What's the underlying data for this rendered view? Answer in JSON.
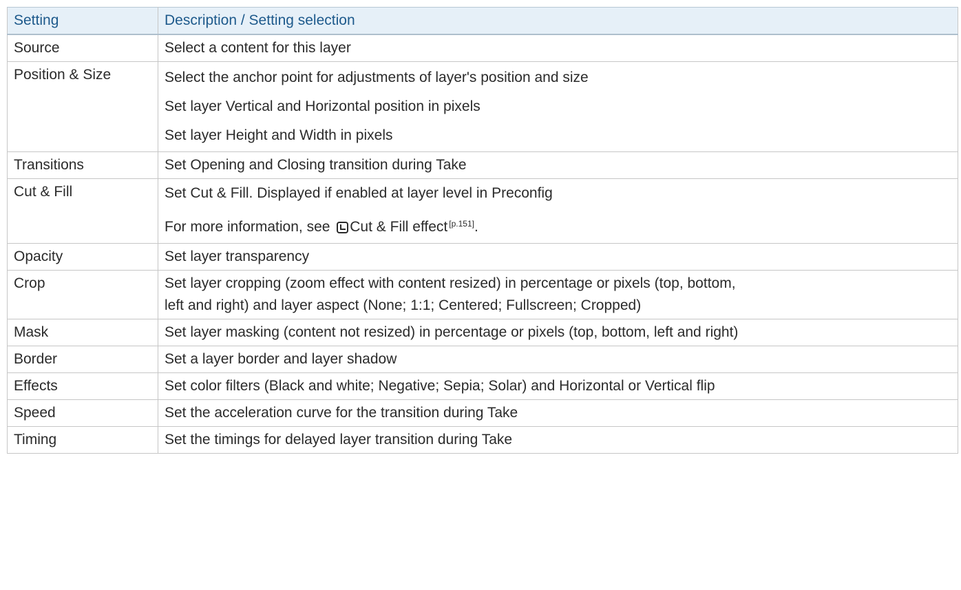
{
  "header": {
    "setting": "Setting",
    "description": "Description / Setting selection"
  },
  "rows": [
    {
      "setting": "Source",
      "lines": [
        "Select a content for this layer"
      ]
    },
    {
      "setting": "Position & Size",
      "lines": [
        "Select the anchor point for adjustments of layer's position and size",
        "Set layer Vertical and Horizontal position in pixels",
        "Set layer Height and Width in pixels"
      ]
    },
    {
      "setting": "Transitions",
      "lines": [
        "Set Opening and Closing transition during Take"
      ]
    },
    {
      "setting": "Cut & Fill",
      "lines": [
        "Set Cut & Fill. Displayed if enabled at layer level in Preconfig"
      ],
      "reference": {
        "prefix": "For more information, see ",
        "link_text": "Cut & Fill effect",
        "page_ref": "[p.151]",
        "suffix": ".",
        "icon": "link-arrow-icon"
      }
    },
    {
      "setting": "Opacity",
      "lines": [
        "Set layer transparency"
      ]
    },
    {
      "setting": "Crop",
      "lines": [
        "Set layer cropping (zoom effect with content resized) in percentage or pixels (top, bottom,",
        "left and right) and layer aspect (None; 1:1; Centered; Fullscreen; Cropped)"
      ]
    },
    {
      "setting": "Mask",
      "lines": [
        "Set layer masking (content not resized) in percentage or pixels (top, bottom, left and right)"
      ]
    },
    {
      "setting": "Border",
      "lines": [
        "Set a layer border and layer shadow"
      ]
    },
    {
      "setting": "Effects",
      "lines": [
        "Set color filters (Black and white; Negative; Sepia; Solar) and Horizontal or Vertical flip"
      ]
    },
    {
      "setting": "Speed",
      "lines": [
        "Set the acceleration curve for the transition during Take"
      ]
    },
    {
      "setting": "Timing",
      "lines": [
        "Set the timings for delayed layer transition during Take"
      ]
    }
  ],
  "colors": {
    "header_bg": "#e6f0f8",
    "header_text": "#1e5a8c",
    "border": "#c6c6c6",
    "body_text": "#2b2b2b"
  }
}
